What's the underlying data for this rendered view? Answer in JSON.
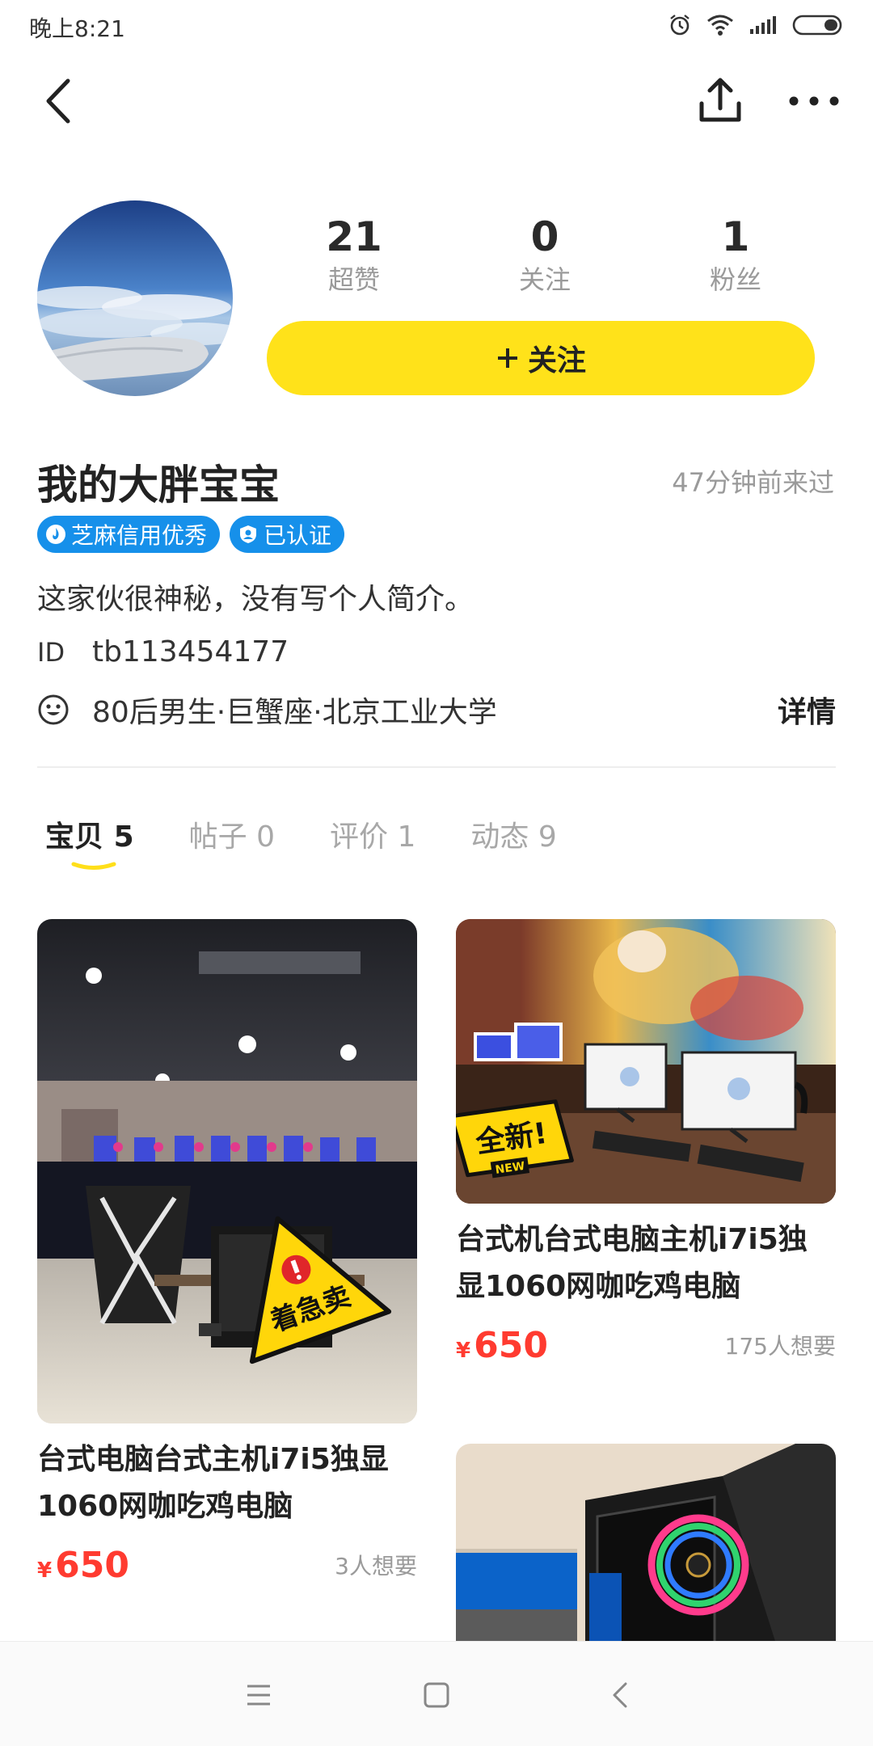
{
  "status_bar": {
    "time": "晚上8:21",
    "icons": [
      "alarm-icon",
      "wifi-icon",
      "signal-icon",
      "battery-icon"
    ]
  },
  "header": {
    "back_icon": "back-chevron-icon",
    "share_icon": "share-icon",
    "more_icon": "more-dots-icon"
  },
  "profile": {
    "stats": [
      {
        "value": "21",
        "label": "超赞"
      },
      {
        "value": "0",
        "label": "关注"
      },
      {
        "value": "1",
        "label": "粉丝"
      }
    ],
    "follow_label": "关注",
    "username": "我的大胖宝宝",
    "last_seen": "47分钟前来过",
    "badges": [
      {
        "label": "芝麻信用优秀",
        "icon": "flame-icon"
      },
      {
        "label": "已认证",
        "icon": "verified-user-icon"
      }
    ],
    "bio": "这家伙很神秘，没有写个人简介。",
    "id_label": "ID",
    "id_value": "tb113454177",
    "info": "80后男生·巨蟹座·北京工业大学",
    "detail_label": "详情"
  },
  "tabs": [
    {
      "label": "宝贝",
      "count": "5",
      "active": true
    },
    {
      "label": "帖子",
      "count": "0",
      "active": false
    },
    {
      "label": "评价",
      "count": "1",
      "active": false
    },
    {
      "label": "动态",
      "count": "9",
      "active": false
    }
  ],
  "items": [
    {
      "title": "台式电脑台式主机i7i5独显1060网咖吃鸡电脑",
      "currency": "¥",
      "price": "650",
      "wants": "3人想要",
      "sticker": "着急卖"
    },
    {
      "title": "台式机台式电脑主机i7i5独显1060网咖吃鸡电脑",
      "currency": "¥",
      "price": "650",
      "wants": "175人想要",
      "sticker": "全新!",
      "sticker_sub": "NEW"
    },
    {
      "title": "",
      "currency": "",
      "price": "",
      "wants": ""
    }
  ],
  "colors": {
    "accent_yellow": "#ffe21a",
    "price_red": "#ff3b30",
    "badge_blue": "#1690ea"
  },
  "system_nav": [
    "menu-icon",
    "home-square-icon",
    "back-triangle-icon"
  ]
}
